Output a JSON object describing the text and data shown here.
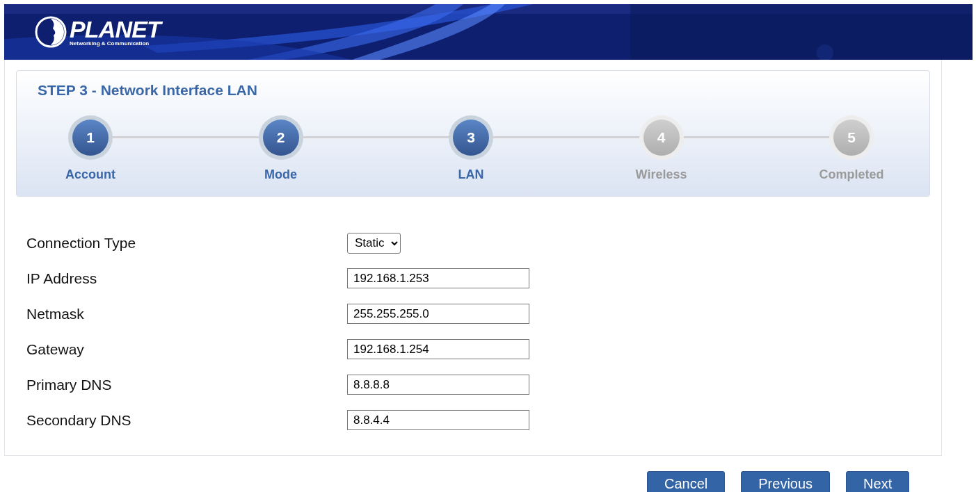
{
  "logo": {
    "name": "PLANET",
    "tagline": "Networking & Communication"
  },
  "wizard": {
    "title": "STEP 3 - Network Interface LAN",
    "steps": [
      {
        "number": "1",
        "label": "Account",
        "active": true
      },
      {
        "number": "2",
        "label": "Mode",
        "active": true
      },
      {
        "number": "3",
        "label": "LAN",
        "active": true
      },
      {
        "number": "4",
        "label": "Wireless",
        "active": false
      },
      {
        "number": "5",
        "label": "Completed",
        "active": false
      }
    ]
  },
  "form": [
    {
      "kind": "select",
      "label": "Connection Type",
      "value": "Static"
    },
    {
      "kind": "input",
      "label": "IP Address",
      "value": "192.168.1.253"
    },
    {
      "kind": "input",
      "label": "Netmask",
      "value": "255.255.255.0"
    },
    {
      "kind": "input",
      "label": "Gateway",
      "value": "192.168.1.254"
    },
    {
      "kind": "input",
      "label": "Primary DNS",
      "value": "8.8.8.8"
    },
    {
      "kind": "input",
      "label": "Secondary DNS",
      "value": "8.8.4.4"
    }
  ],
  "buttons": [
    "Cancel",
    "Previous",
    "Next"
  ]
}
